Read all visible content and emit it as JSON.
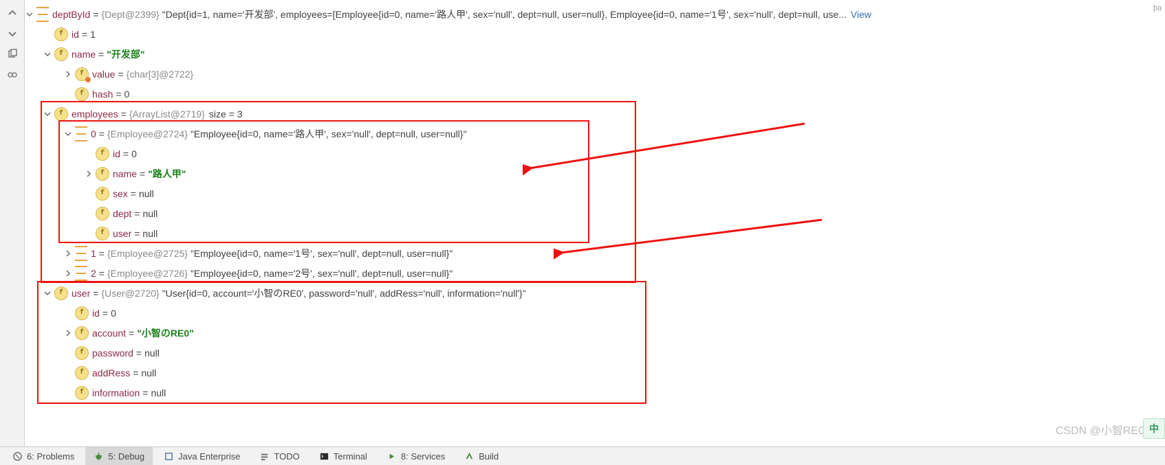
{
  "gutter": {
    "copy": "copy",
    "goggles": "toggle"
  },
  "root": {
    "name": "deptById",
    "type": "{Dept@2399}",
    "repr": "\"Dept{id=1, name='开发部', employees=[Employee{id=0, name='路人甲', sex='null', dept=null, user=null}, Employee{id=0, name='1号', sex='null', dept=null, use...",
    "view": "View"
  },
  "id": {
    "name": "id",
    "val": "1"
  },
  "name_field": {
    "name": "name",
    "val": "\"开发部\""
  },
  "name_value": {
    "name": "value",
    "type": "{char[3]@2722}"
  },
  "hash": {
    "name": "hash",
    "val": "0"
  },
  "employees": {
    "name": "employees",
    "type": "{ArrayList@2719}",
    "extra": "size = 3"
  },
  "emp0": {
    "idx": "0",
    "type": "{Employee@2724}",
    "repr": "\"Employee{id=0, name='路人甲', sex='null', dept=null, user=null}\""
  },
  "emp0_fields": {
    "id": {
      "n": "id",
      "v": "0"
    },
    "name": {
      "n": "name",
      "v": "\"路人甲\""
    },
    "sex": {
      "n": "sex",
      "v": "null"
    },
    "dept": {
      "n": "dept",
      "v": "null"
    },
    "user": {
      "n": "user",
      "v": "null"
    }
  },
  "emp1": {
    "idx": "1",
    "type": "{Employee@2725}",
    "repr": "\"Employee{id=0, name='1号', sex='null', dept=null, user=null}\""
  },
  "emp2": {
    "idx": "2",
    "type": "{Employee@2726}",
    "repr": "\"Employee{id=0, name='2号', sex='null', dept=null, user=null}\""
  },
  "user": {
    "name": "user",
    "type": "{User@2720}",
    "repr": "\"User{id=0, account='小智のRE0', password='null', addRess='null', information='null'}\""
  },
  "user_fields": {
    "id": {
      "n": "id",
      "v": "0"
    },
    "account": {
      "n": "account",
      "v": "\"小智のRE0\""
    },
    "password": {
      "n": "password",
      "v": "null"
    },
    "addRess": {
      "n": "addRess",
      "v": "null"
    },
    "information": {
      "n": "information",
      "v": "null"
    }
  },
  "tabs": {
    "problems": "6: Problems",
    "debug": "5: Debug",
    "java": "Java Enterprise",
    "todo": "TODO",
    "terminal": "Terminal",
    "services": "8: Services",
    "build": "Build"
  },
  "ime": "中",
  "watermark": "CSDN @小智RE0",
  "rpad": "þa"
}
